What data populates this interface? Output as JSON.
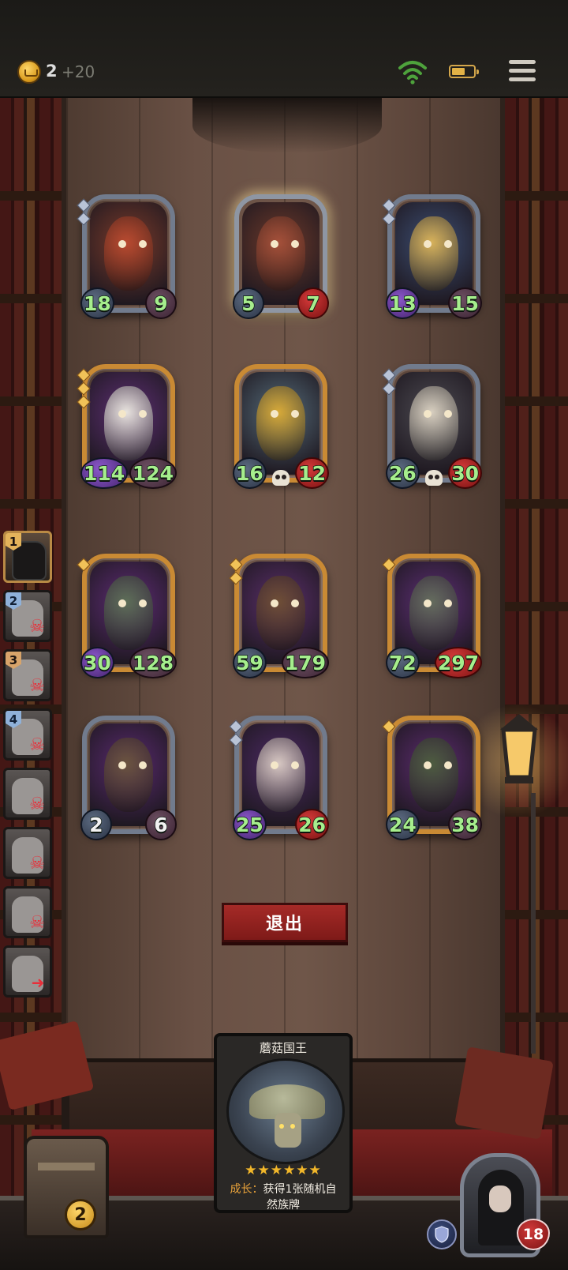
{
  "status_bar": {
    "gold": "2",
    "gold_bonus": "+20",
    "icons": [
      "wifi-icon",
      "battery-icon",
      "menu-icon"
    ]
  },
  "board": {
    "cards": [
      {
        "name": "red-dragon-card",
        "attack": "18",
        "health": "9",
        "frame": "silver",
        "gems": 2,
        "skull": false
      },
      {
        "name": "fire-drake-card",
        "attack": "5",
        "health": "7",
        "frame": "silver-glow",
        "gems": 0,
        "skull": false
      },
      {
        "name": "armored-knight-card",
        "attack": "13",
        "health": "15",
        "frame": "silver",
        "gems": 2,
        "skull": false
      },
      {
        "name": "griffin-bird-card",
        "attack": "114",
        "health": "124",
        "frame": "gold",
        "gems": 3,
        "skull": false
      },
      {
        "name": "golden-dragon-card",
        "attack": "16",
        "health": "12",
        "frame": "gold",
        "gems": 0,
        "skull": true
      },
      {
        "name": "bone-dragon-card",
        "attack": "26",
        "health": "30",
        "frame": "silver",
        "gems": 2,
        "skull": true
      },
      {
        "name": "moss-golem-card",
        "attack": "30",
        "health": "128",
        "frame": "gold",
        "gems": 1,
        "skull": false
      },
      {
        "name": "tiki-totem-card",
        "attack": "59",
        "health": "179",
        "frame": "gold",
        "gems": 2,
        "skull": false
      },
      {
        "name": "stone-golem-card",
        "attack": "72",
        "health": "297",
        "frame": "gold",
        "gems": 1,
        "skull": false
      },
      {
        "name": "plague-doctor-card",
        "attack": "2",
        "health": "6",
        "frame": "silver",
        "gems": 0,
        "skull": false
      },
      {
        "name": "masked-rabbit-card",
        "attack": "25",
        "health": "26",
        "frame": "silver",
        "gems": 2,
        "skull": false
      },
      {
        "name": "mushroom-goblin-card",
        "attack": "24",
        "health": "38",
        "frame": "gold",
        "gems": 1,
        "skull": false
      }
    ]
  },
  "roster": [
    {
      "rank": "1",
      "status": "alive"
    },
    {
      "rank": "2",
      "status": "dead"
    },
    {
      "rank": "3",
      "status": "dead"
    },
    {
      "rank": "4",
      "status": "dead"
    },
    {
      "rank": "",
      "status": "dead"
    },
    {
      "rank": "",
      "status": "dead"
    },
    {
      "rank": "",
      "status": "dead"
    },
    {
      "rank": "",
      "status": "fled"
    }
  ],
  "exit_button": {
    "label": "退出"
  },
  "featured_card": {
    "title": "蘑菇国王",
    "stars": "★★★★★★",
    "star_count": 6,
    "desc_key": "成长：",
    "desc_text": "获得1张随机自然族牌"
  },
  "chest": {
    "count": "2"
  },
  "player": {
    "health": "18"
  },
  "colors": {
    "accent_red": "#a52a27",
    "stat_green": "#a6ee8d",
    "gold_frame": "#c98a34",
    "silver_frame": "#717b8d"
  }
}
